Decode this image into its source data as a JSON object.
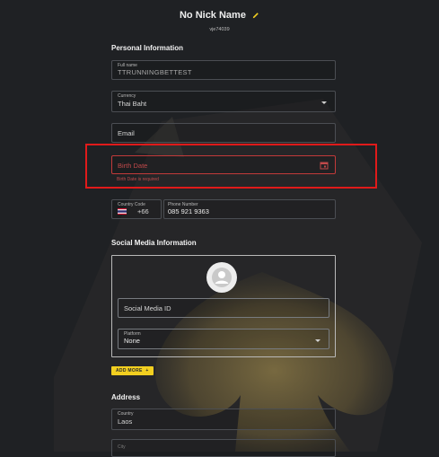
{
  "header": {
    "nickname": "No Nick Name",
    "username": "vje74039"
  },
  "personal": {
    "section_title": "Personal Information",
    "full_name": {
      "label": "Full name",
      "value": "TTRUNNINGBETTEST"
    },
    "currency": {
      "label": "Currency",
      "value": "Thai Baht"
    },
    "email": {
      "placeholder": "Email"
    },
    "birth_date": {
      "placeholder": "Birth Date",
      "error": "Birth Date is required"
    },
    "country_code": {
      "label": "Country Code",
      "value": "+66"
    },
    "phone": {
      "label": "Phone Number",
      "value": "085 921 9363"
    }
  },
  "social": {
    "section_title": "Social Media Information",
    "social_id": {
      "placeholder": "Social Media ID"
    },
    "platform": {
      "label": "Platform",
      "value": "None"
    },
    "add_more": "ADD MORE"
  },
  "address": {
    "section_title": "Address",
    "country": {
      "label": "Country",
      "value": "Laos"
    },
    "city": {
      "label": "City"
    }
  },
  "colors": {
    "background": "#1f2124",
    "accent_yellow": "#f2cf20",
    "error_red": "#c0494a",
    "highlight_red": "#e01a1a",
    "field_border": "#4b4e53"
  },
  "icons": [
    "pencil-icon",
    "calendar-icon",
    "thai-flag-icon",
    "avatar-icon",
    "dropdown-caret-icon",
    "plus-icon"
  ]
}
